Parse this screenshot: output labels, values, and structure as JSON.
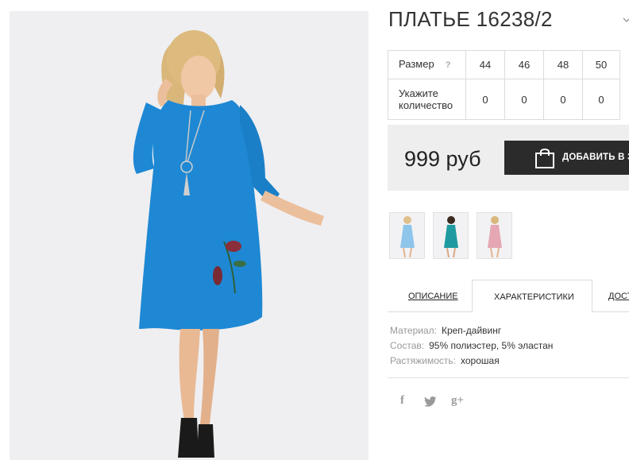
{
  "product": {
    "title": "ПЛАТЬЕ 16238/2",
    "main_image_alt": "model-in-blue-dress"
  },
  "size_table": {
    "size_label": "Размер",
    "help_icon": "?",
    "sizes": [
      "44",
      "46",
      "48",
      "50"
    ],
    "qty_label_line1": "Укажите",
    "qty_label_line2": "количество",
    "quantities": [
      "0",
      "0",
      "0",
      "0"
    ]
  },
  "price": {
    "value": "999 руб",
    "add_to_cart_label": "ДОБАВИТЬ В ЗАКАЗ"
  },
  "thumbnails": [
    {
      "name": "thumb-light-blue",
      "color": "#8ec5ea"
    },
    {
      "name": "thumb-teal",
      "color": "#1f9aa0"
    },
    {
      "name": "thumb-pink",
      "color": "#e5a7b3"
    }
  ],
  "tabs": {
    "description": "Описание",
    "specifications": "Характеристики",
    "delivery": "Доставка",
    "active": "specifications"
  },
  "specs": [
    {
      "key": "Материал:",
      "value": "Креп-дайвинг"
    },
    {
      "key": "Состав:",
      "value": "95% полиэстер, 5% эластан"
    },
    {
      "key": "Растяжимость:",
      "value": "хорошая"
    }
  ],
  "social": {
    "facebook": "f",
    "twitter_icon": "twitter-bird",
    "google": "g+"
  },
  "colors": {
    "dress": "#1e88d4",
    "button_bg": "#2b2b2b",
    "price_bg": "#eeeeee"
  }
}
